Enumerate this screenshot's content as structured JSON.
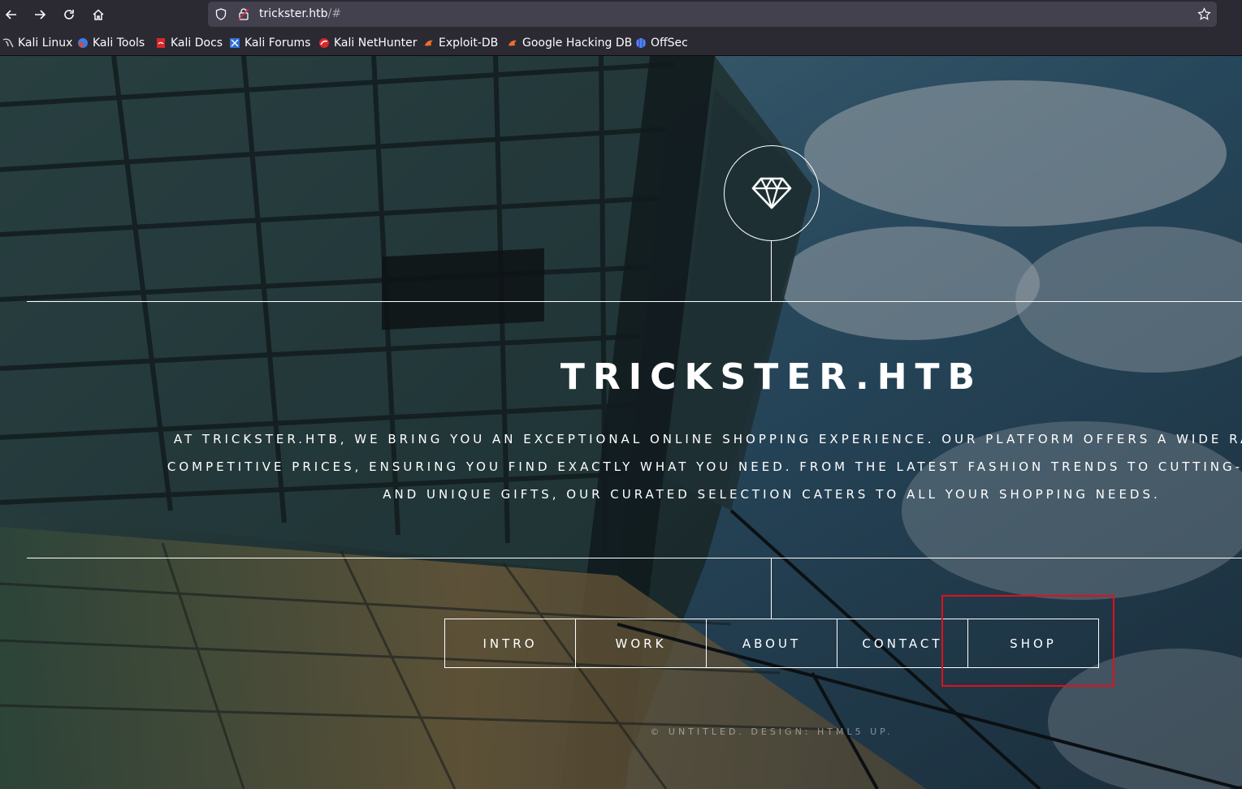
{
  "browser": {
    "url_host": "trickster.htb",
    "url_path": "/#",
    "bookmarks": [
      {
        "label": "Kali Linux",
        "icon": "kali-dragon-icon"
      },
      {
        "label": "Kali Tools",
        "icon": "kali-tools-icon"
      },
      {
        "label": "Kali Docs",
        "icon": "kali-docs-icon"
      },
      {
        "label": "Kali Forums",
        "icon": "kali-forums-icon"
      },
      {
        "label": "Kali NetHunter",
        "icon": "kali-nethunter-icon"
      },
      {
        "label": "Exploit-DB",
        "icon": "exploit-db-icon"
      },
      {
        "label": "Google Hacking DB",
        "icon": "google-hacking-db-icon"
      },
      {
        "label": "OffSec",
        "icon": "offsec-icon"
      }
    ]
  },
  "site": {
    "logo_icon": "diamond-icon",
    "title": "TRICKSTER.HTB",
    "intro_lines": [
      "AT TRICKSTER.HTB, WE BRING YOU AN EXCEPTIONAL ONLINE SHOPPING EXPERIENCE. OUR PLATFORM OFFERS A WIDE RANGE OF HIGH",
      "COMPETITIVE PRICES, ENSURING YOU FIND EXACTLY WHAT YOU NEED. FROM THE LATEST FASHION TRENDS TO CUTTING-EDGE ELECTRO",
      "AND UNIQUE GIFTS, OUR CURATED SELECTION CATERS TO ALL YOUR SHOPPING NEEDS."
    ],
    "nav": [
      "INTRO",
      "WORK",
      "ABOUT",
      "CONTACT",
      "SHOP"
    ],
    "footer": "© UNTITLED. DESIGN: HTML5 UP."
  },
  "colors": {
    "chrome": "#2b2a33",
    "urlbar": "#42414d",
    "highlight": "#e0101b",
    "text": "#ffffff"
  }
}
